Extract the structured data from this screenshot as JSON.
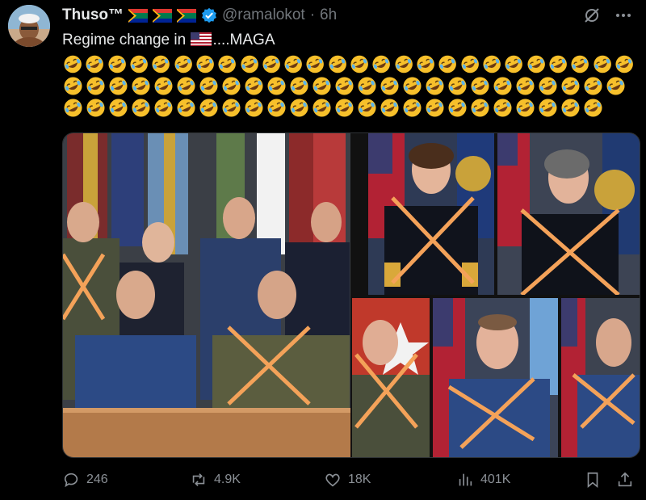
{
  "post": {
    "display_name": "Thuso™",
    "handle": "@ramalokot",
    "separator": "·",
    "time": "6h",
    "text_before": "Regime change in",
    "text_after": "....MAGA",
    "emoji_rows": [
      26,
      25,
      24
    ]
  },
  "actions": {
    "replies": "246",
    "reposts": "4.9K",
    "likes": "18K",
    "views": "401K"
  },
  "icons": {
    "flags": [
      "south-africa-flag",
      "south-africa-flag",
      "south-africa-flag"
    ],
    "verified": "verified-badge-icon",
    "grok": "grok-icon",
    "more": "more-icon",
    "us_flag": "us-flag",
    "emoji": "rolling-on-floor-laughing-emoji"
  },
  "colors": {
    "background": "#000000",
    "text": "#e7e9ea",
    "muted": "#71767b",
    "verified": "#1d9bf0",
    "cross": "#f4a259"
  }
}
